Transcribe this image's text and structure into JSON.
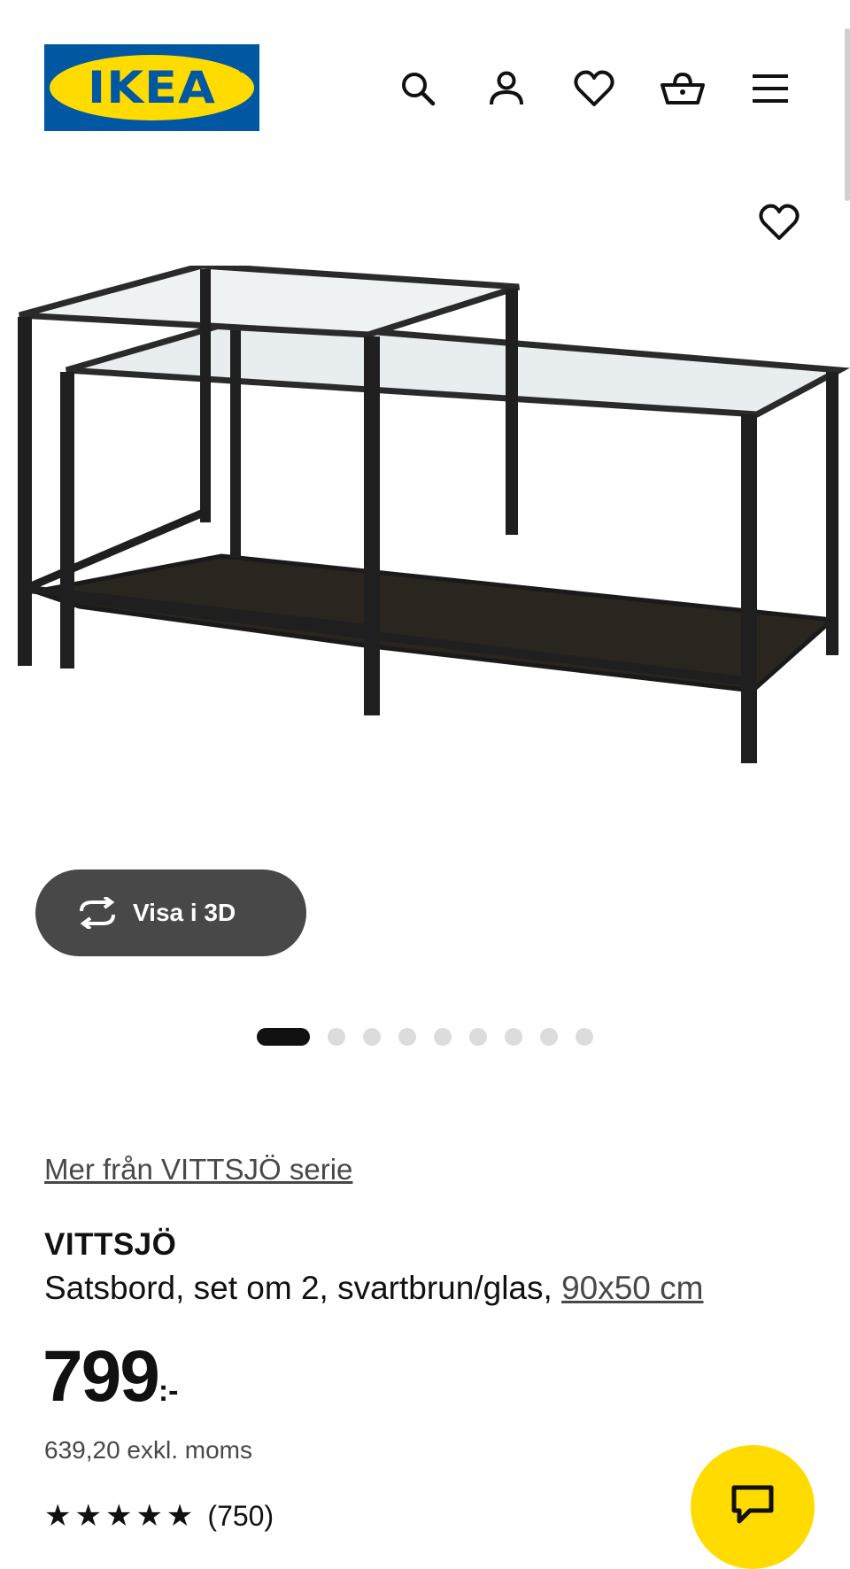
{
  "header": {
    "logo_text": "IKEA",
    "logo_colors": {
      "background": "#0058a3",
      "oval": "#ffdb00"
    },
    "icons": [
      "search-icon",
      "account-icon",
      "heart-icon",
      "basket-icon",
      "menu-icon"
    ]
  },
  "gallery": {
    "favourite_icon": "heart-icon",
    "view3d_label": "Visa i 3D",
    "slide_count": 9,
    "active_slide": 1
  },
  "product": {
    "series_link": "Mer från VITTSJÖ serie",
    "name": "VITTSJÖ",
    "description": "Satsbord, set om 2, svartbrun/glas,",
    "dimensions": "90x50 cm",
    "price": "799",
    "price_suffix": ":-",
    "price_excl_vat": "639,20 exkl. moms",
    "rating_stars": "★★★★★",
    "rating_count": "(750)"
  },
  "chat": {
    "icon": "chat-icon",
    "color": "#ffdb00"
  }
}
